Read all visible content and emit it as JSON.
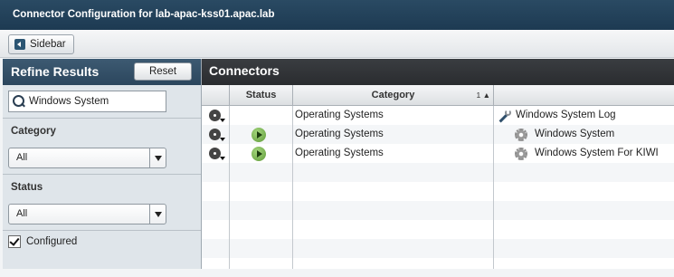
{
  "window": {
    "title": "Connector Configuration for lab-apac-kss01.apac.lab"
  },
  "toolbar": {
    "sidebar_label": "Sidebar"
  },
  "refine": {
    "title": "Refine Results",
    "reset_label": "Reset",
    "search_value": "Windows System",
    "category_label": "Category",
    "category_value": "All",
    "status_label": "Status",
    "status_value": "All",
    "configured_label": "Configured",
    "configured_checked": true
  },
  "connectors": {
    "title": "Connectors",
    "columns": {
      "status": "Status",
      "category": "Category",
      "sort_indicator": "1 ▲"
    },
    "rows": [
      {
        "category": "Operating Systems",
        "name": "Windows System Log",
        "icon": "wrench-icon",
        "status": ""
      },
      {
        "category": "Operating Systems",
        "name": "Windows System",
        "icon": "gear-icon",
        "status": "running"
      },
      {
        "category": "Operating Systems",
        "name": "Windows System For KIWI",
        "icon": "gear-icon",
        "status": "running"
      }
    ]
  },
  "colors": {
    "title_bar": "#1d3a52",
    "panel_header": "#2b465d",
    "grid_header": "#2a2c2f",
    "status_running": "#5d9a37"
  }
}
